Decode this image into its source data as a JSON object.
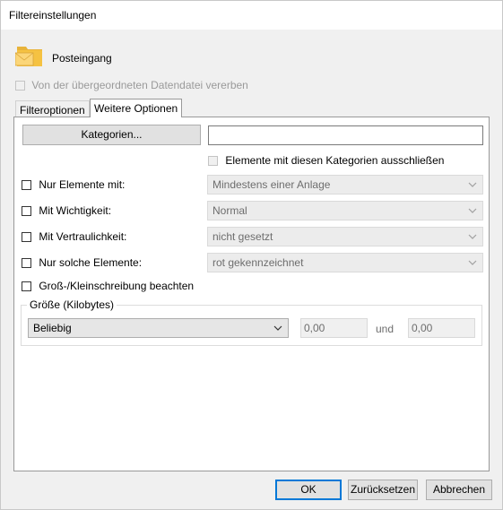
{
  "window": {
    "title": "Filtereinstellungen"
  },
  "folder": {
    "name": "Posteingang",
    "icon": "folder-mail-icon"
  },
  "inherit": {
    "label": "Von der übergeordneten Datendatei vererben",
    "checked": false,
    "enabled": false
  },
  "tabs": [
    {
      "label": "Filteroptionen",
      "active": false
    },
    {
      "label": "Weitere Optionen",
      "active": true
    }
  ],
  "categories": {
    "button_label": "Kategorien...",
    "value": "",
    "exclude_label": "Elemente mit diesen Kategorien ausschließen",
    "exclude_enabled": false
  },
  "options": [
    {
      "label": "Nur Elemente mit:",
      "checked": false,
      "selected": "Mindestens einer Anlage"
    },
    {
      "label": "Mit Wichtigkeit:",
      "checked": false,
      "selected": "Normal"
    },
    {
      "label": "Mit Vertraulichkeit:",
      "checked": false,
      "selected": "nicht gesetzt"
    },
    {
      "label": "Nur solche Elemente:",
      "checked": false,
      "selected": "rot gekennzeichnet"
    }
  ],
  "case_sensitive": {
    "label": "Groß-/Kleinschreibung beachten",
    "checked": false
  },
  "size": {
    "group_label": "Größe (Kilobytes)",
    "selected": "Beliebig",
    "from": "0,00",
    "and_label": "und",
    "to": "0,00"
  },
  "buttons": {
    "ok": "OK",
    "reset": "Zurücksetzen",
    "cancel": "Abbrechen"
  },
  "colors": {
    "accent": "#0078d7",
    "folder": "#f5c242"
  }
}
